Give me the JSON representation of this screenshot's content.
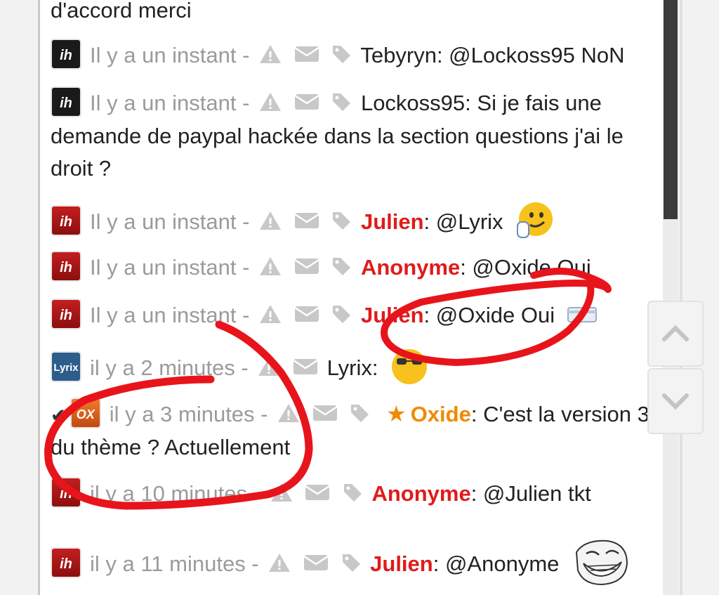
{
  "top_text": "d'accord merci",
  "messages": [
    {
      "avatar": "ih",
      "time": "Il y a un instant -",
      "user": "Tebyryn",
      "text": ": @Lockoss95 NoN"
    },
    {
      "avatar": "ih",
      "time": "Il y a un instant -",
      "user": "Lockoss95",
      "text": ": Si je fais une demande de paypal hackée dans la section questions j'ai le droit ?"
    },
    {
      "avatar": "ih",
      "time": "Il y a un instant -",
      "user": "Julien",
      "text": ": @Lyrix"
    },
    {
      "avatar": "ih",
      "time": "Il y a un instant -",
      "user": "Anonyme",
      "text": ": @Oxide Oui"
    },
    {
      "avatar": "ih",
      "time": "Il y a un instant -",
      "user": "Julien",
      "text": ": @Oxide Oui"
    },
    {
      "avatar": "Lyrix",
      "time": "il y a 2 minutes -",
      "user": "Lyrix",
      "text": ":"
    },
    {
      "avatar": "OX",
      "time": "il y a 3 minutes -",
      "user": "Oxide",
      "text": ": C'est la version 3 du thème ? Actuellement"
    },
    {
      "avatar": "ih",
      "time": "il y a 10 minutes -",
      "user": "Anonyme",
      "text": ": @Julien tkt"
    },
    {
      "avatar": "ih",
      "time": "il y a 11 minutes -",
      "user": "Julien",
      "text": ": @Anonyme"
    }
  ],
  "colors": {
    "highlight_red": "#e01b1b",
    "highlight_orange": "#f08a00",
    "annotation": "#e8141b",
    "time_gray": "#9b9b9b"
  },
  "icons": [
    "warning-icon",
    "mail-icon",
    "tag-icon",
    "star-icon",
    "check-icon",
    "chevron-up-icon",
    "chevron-down-icon"
  ]
}
